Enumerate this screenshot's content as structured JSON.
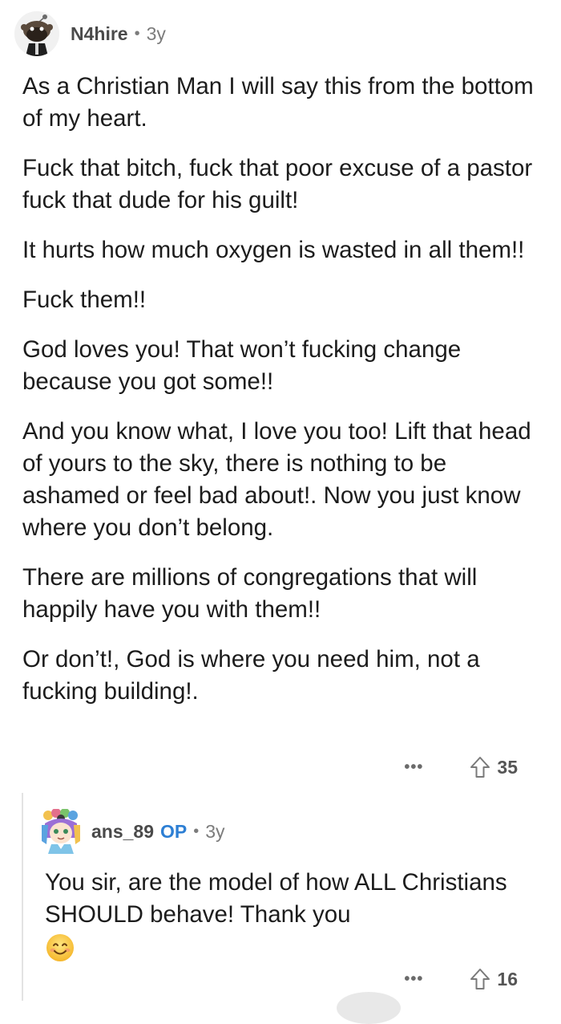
{
  "comments": [
    {
      "username": "N4hire",
      "separator": "•",
      "time": "3y",
      "paragraphs": [
        "As a Christian Man I will say this from the bottom of my heart.",
        "Fuck that bitch, fuck that poor excuse of a pastor fuck that dude for his guilt!",
        "It hurts how much oxygen is wasted in all them!!",
        "Fuck them!!",
        "God loves you! That won’t fucking change because you got some!!",
        "And you know what, I love you too! Lift that head of yours to the sky, there is nothing to be ashamed or feel bad about!. Now you just know where you don’t belong.",
        "There  are millions of congregations that will happily have you with them!!",
        "Or don’t!, God is where you need him, not a fucking building!."
      ],
      "more_label": "•••",
      "score": "35",
      "avatar_icon": "snoo-avatar-icon"
    },
    {
      "username": "ans_89",
      "op_badge": "OP",
      "separator": "•",
      "time": "3y",
      "text": "You sir, are the model of how ALL Christians SHOULD behave! Thank you",
      "emoji_icon": "smiling-face-emoji-icon",
      "more_label": "•••",
      "score": "16",
      "avatar_icon": "rainbow-hair-avatar-icon"
    }
  ],
  "colors": {
    "op_badge": "#2d7fd4",
    "meta_text": "#7c7c7c",
    "thread_line": "#e3e3e3"
  }
}
